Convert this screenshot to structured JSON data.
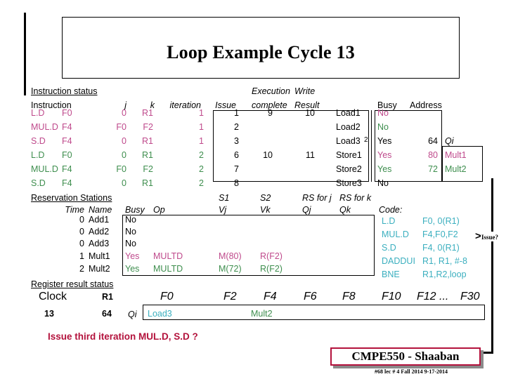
{
  "slide": {
    "title": "Loop Example Cycle 13",
    "bottom_question": "Issue third iteration MUL.D,  S.D ?",
    "annotation": "Issue?",
    "arrow_glyph": "〉"
  },
  "colors": {
    "iteration1": "#bf4a8c",
    "iteration2": "#3e8e4e",
    "code": "#3bafbf",
    "question": "#b3123c",
    "banner_border": "#b3123c"
  },
  "instruction_status": {
    "section_label": "Instruction status",
    "headers": {
      "instruction": "Instruction",
      "j": "j",
      "k": "k",
      "iteration": "iteration",
      "issue": "Issue",
      "execution": "Execution",
      "complete": "complete",
      "write": "Write",
      "result": "Result"
    },
    "rows": [
      {
        "instruction": "L.D",
        "dest": "F0",
        "j": "0",
        "k": "R1",
        "iteration": "1",
        "issue": "1",
        "complete": "9",
        "result": "10",
        "color": "iteration1"
      },
      {
        "instruction": "MUL.D",
        "dest": "F4",
        "j": "F0",
        "k": "F2",
        "iteration": "1",
        "issue": "2",
        "complete": "",
        "result": "",
        "color": "iteration1"
      },
      {
        "instruction": "S.D",
        "dest": "F4",
        "j": "0",
        "k": "R1",
        "iteration": "1",
        "issue": "3",
        "complete": "",
        "result": "",
        "color": "iteration1"
      },
      {
        "instruction": "L.D",
        "dest": "F0",
        "j": "0",
        "k": "R1",
        "iteration": "2",
        "issue": "6",
        "complete": "10",
        "result": "11",
        "color": "iteration2"
      },
      {
        "instruction": "MUL.D",
        "dest": "F4",
        "j": "F0",
        "k": "F2",
        "iteration": "2",
        "issue": "7",
        "complete": "",
        "result": "",
        "color": "iteration2"
      },
      {
        "instruction": "S.D",
        "dest": "F4",
        "j": "0",
        "k": "R1",
        "iteration": "2",
        "issue": "8",
        "complete": "",
        "result": "",
        "color": "iteration2"
      }
    ]
  },
  "load_store_units": {
    "headers": {
      "busy": "Busy",
      "address": "Address",
      "qi": "Qi"
    },
    "rows": [
      {
        "name": "Load1",
        "sup": "",
        "busy": "No",
        "address": "",
        "qi": "",
        "color": "iteration1"
      },
      {
        "name": "Load2",
        "sup": "",
        "busy": "No",
        "address": "",
        "qi": "",
        "color": "iteration2"
      },
      {
        "name": "Load3",
        "sup": "2",
        "busy": "Yes",
        "address": "64",
        "qi": "",
        "color": "black"
      },
      {
        "name": "Store1",
        "sup": "",
        "busy": "Yes",
        "address": "80",
        "qi": "Mult1",
        "color": "iteration1"
      },
      {
        "name": "Store2",
        "sup": "",
        "busy": "Yes",
        "address": "72",
        "qi": "Mult2",
        "color": "iteration2"
      },
      {
        "name": "Store3",
        "sup": "",
        "busy": "No",
        "address": "",
        "qi": "",
        "color": "black"
      }
    ]
  },
  "reservation_stations": {
    "section_label": "Reservation Stations",
    "headers": {
      "time": "Time",
      "name": "Name",
      "busy": "Busy",
      "op": "Op",
      "s1": "S1",
      "s2": "S2",
      "vj": "Vj",
      "vk": "Vk",
      "rs_for_j": "RS for j",
      "rs_for_k": "RS for k",
      "qj": "Qj",
      "qk": "Qk"
    },
    "rows": [
      {
        "time": "0",
        "name": "Add1",
        "busy": "No",
        "op": "",
        "vj": "",
        "vk": "",
        "qj": "",
        "qk": "",
        "color": "black"
      },
      {
        "time": "0",
        "name": "Add2",
        "busy": "No",
        "op": "",
        "vj": "",
        "vk": "",
        "qj": "",
        "qk": "",
        "color": "black"
      },
      {
        "time": "0",
        "name": "Add3",
        "busy": "No",
        "op": "",
        "vj": "",
        "vk": "",
        "qj": "",
        "qk": "",
        "color": "black"
      },
      {
        "time": "1",
        "name": "Mult1",
        "busy": "Yes",
        "op": "MULTD",
        "vj": "M(80)",
        "vk": "R(F2)",
        "qj": "",
        "qk": "",
        "color": "iteration1"
      },
      {
        "time": "2",
        "name": "Mult2",
        "busy": "Yes",
        "op": "MULTD",
        "vj": "M(72)",
        "vk": "R(F2)",
        "qj": "",
        "qk": "",
        "color": "iteration2"
      }
    ]
  },
  "code": {
    "label": "Code:",
    "lines": [
      {
        "op": "L.D",
        "operands": "F0, 0(R1)"
      },
      {
        "op": "MUL.D",
        "operands": "F4,F0,F2"
      },
      {
        "op": "S.D",
        "operands": "F4, 0(R1)"
      },
      {
        "op": "DADDUI",
        "operands": "R1, R1, #-8"
      },
      {
        "op": "BNE",
        "operands": "R1,R2,loop"
      }
    ]
  },
  "register_result_status": {
    "section_label": "Register result status",
    "clock_label": "Clock",
    "clock_value": "13",
    "r1_label": "R1",
    "r1_value": "64",
    "qi_label": "Qi",
    "registers": [
      "F0",
      "F2",
      "F4",
      "F6",
      "F8",
      "F10",
      "F12 ...",
      "F30"
    ],
    "values": [
      {
        "reg": "F0",
        "value": "Load3",
        "color": "code"
      },
      {
        "reg": "F4",
        "value": "Mult2",
        "color": "iteration2"
      }
    ]
  },
  "footer": {
    "banner": "CMPE550 - Shaaban",
    "subtitle": "#68   lec # 4 Fall 2014   9-17-2014"
  }
}
